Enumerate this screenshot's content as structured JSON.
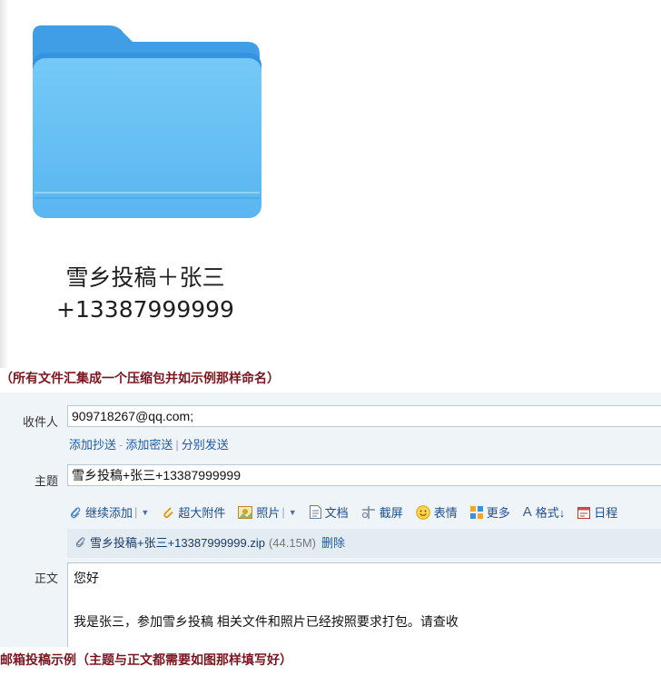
{
  "folder": {
    "name_line1": "雪乡投稿＋张三",
    "name_line2": "+13387999999",
    "icon": "folder-icon",
    "colors": {
      "front": "#6cc3f5",
      "back": "#3f9ee6"
    }
  },
  "captions": {
    "top": "（所有文件汇集成一个压缩包并如示例那样命名）",
    "bottom": "邮箱投稿示例（主题与正文都需要如图那样填写好）"
  },
  "compose": {
    "to_label": "收件人",
    "to_value": "909718267@qq.com;",
    "cc_link": "添加抄送",
    "bcc_link": "添加密送",
    "separate_link": "分别发送",
    "subject_label": "主题",
    "subject_value": "雪乡投稿+张三+13387999999",
    "toolbar": {
      "continue_add": "继续添加",
      "large_attach": "超大附件",
      "photo": "照片",
      "document": "文档",
      "screenshot": "截屏",
      "emoji": "表情",
      "more": "更多",
      "format": "格式↓",
      "schedule": "日程"
    },
    "attachment": {
      "name": "雪乡投稿+张三+13387999999.zip",
      "size": "(44.15M)",
      "delete": "删除"
    },
    "body_label": "正文",
    "body_line1": "您好",
    "body_line2": "我是张三，参加雪乡投稿 相关文件和照片已经按照要求打包。请查收"
  },
  "colors": {
    "caption": "#7a1520",
    "link": "#1f5ba8",
    "compose_bg": "#eff4f9"
  }
}
